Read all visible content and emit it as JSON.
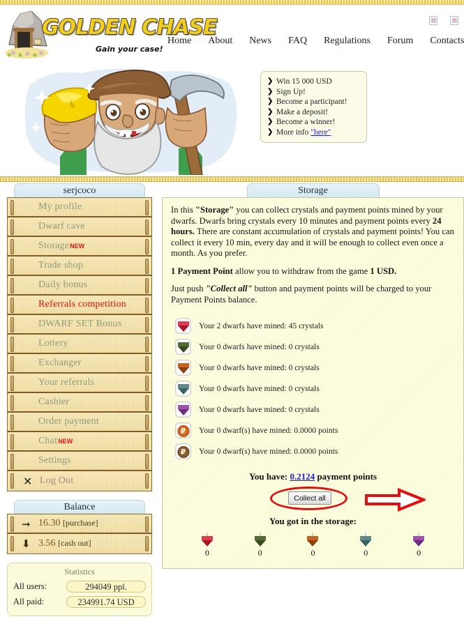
{
  "site": {
    "logo_text": "GOLDEN CHASE",
    "slogan": "Gain your case!"
  },
  "nav": {
    "items": [
      {
        "label": "Home"
      },
      {
        "label": "About"
      },
      {
        "label": "News"
      },
      {
        "label": "FAQ"
      },
      {
        "label": "Regulations"
      },
      {
        "label": "Forum"
      },
      {
        "label": "Contacts"
      }
    ]
  },
  "promo": {
    "items": [
      "Win 15 000 USD",
      "Sign Up!",
      "Become a participant!",
      "Make a deposit!",
      "Become a winner!"
    ],
    "more_info_prefix": "More info",
    "more_info_link": "\"here\""
  },
  "sidebar": {
    "user_tab": "serjcoco",
    "items": [
      {
        "label": "My profile",
        "state": "normal",
        "badge": ""
      },
      {
        "label": "Dwarf cave",
        "state": "normal",
        "badge": ""
      },
      {
        "label": "Storage",
        "state": "normal",
        "badge": "NEW"
      },
      {
        "label": "Trade shop",
        "state": "normal",
        "badge": ""
      },
      {
        "label": "Daily bonus",
        "state": "normal",
        "badge": ""
      },
      {
        "label": "Referrals competition",
        "state": "active",
        "badge": ""
      },
      {
        "label": "DWARF SET Bonus",
        "state": "normal",
        "badge": ""
      },
      {
        "label": "Lottery",
        "state": "normal",
        "badge": ""
      },
      {
        "label": "Exchanger",
        "state": "normal",
        "badge": ""
      },
      {
        "label": "Your referrals",
        "state": "normal",
        "badge": ""
      },
      {
        "label": "Cashier",
        "state": "normal",
        "badge": ""
      },
      {
        "label": "Order payment",
        "state": "normal",
        "badge": ""
      },
      {
        "label": "Chat",
        "state": "normal",
        "badge": "NEW"
      },
      {
        "label": "Settings",
        "state": "normal",
        "badge": ""
      },
      {
        "label": "Log Out",
        "state": "logout",
        "badge": ""
      }
    ],
    "balance": {
      "title": "Balance",
      "rows": [
        {
          "icon": "arrow-right-icon",
          "amount": "16.30",
          "tag": "[purchase]"
        },
        {
          "icon": "arrow-down-icon",
          "amount": "3.56",
          "tag": "[cash out]"
        }
      ]
    },
    "statistics": {
      "title": "Statistics",
      "rows": [
        {
          "label": "All users:",
          "value": "294049 ppl."
        },
        {
          "label": "All paid:",
          "value": "234991.74 USD"
        }
      ]
    }
  },
  "content": {
    "tab_title": "Storage",
    "paragraph1_a": "In this ",
    "paragraph1_b": "\"Storage\"",
    "paragraph1_c": " you can collect crystals and payment points mined by your dwarfs. Dwarfs bring crystals every 10 minutes and payment points every ",
    "paragraph1_d": "24 hours.",
    "paragraph1_e": " There are constant accumulation of crystals and payment points! You can collect it every 10 min, every day and it will be enough to collect even once a month. As you prefer.",
    "paragraph2_a": "1 Payment Point",
    "paragraph2_b": " allow you to withdraw from the game ",
    "paragraph2_c": "1 USD.",
    "paragraph3_a": "Just push ",
    "paragraph3_b": "\"Collect all\"",
    "paragraph3_c": " button and payment points will be charged to your Payment Points balance.",
    "mined_rows": [
      {
        "icon": "red-crystal-icon",
        "color": "#e23a4e",
        "dark": "#a5172a",
        "text": "Your 2 dwarfs have mined: 45 crystals"
      },
      {
        "icon": "green-crystal-icon",
        "color": "#556b33",
        "dark": "#394a1f",
        "text": "Your 0 dwarfs have mined: 0 crystals"
      },
      {
        "icon": "orange-crystal-icon",
        "color": "#c9641c",
        "dark": "#8c4210",
        "text": "Your 0 dwarfs have mined: 0 crystals"
      },
      {
        "icon": "teal-crystal-icon",
        "color": "#5e8a8a",
        "dark": "#3d6263",
        "text": "Your 0 dwarfs have mined: 0 crystals"
      },
      {
        "icon": "purple-crystal-icon",
        "color": "#a24fb0",
        "dark": "#6f2e7d",
        "text": "Your 0 dwarfs have mined: 0 crystals"
      },
      {
        "icon": "orange-coin-icon",
        "color": "#d2691e",
        "dark": "#a34a10",
        "text": "Your 0 dwarf(s) have mined: 0.0000 points",
        "glyph": "₽"
      },
      {
        "icon": "brown-coin-icon",
        "color": "#8a5a2b",
        "dark": "#5e3b17",
        "text": "Your 0 dwarf(s) have mined: 0.0000 points",
        "glyph": "₽"
      }
    ],
    "have_prefix": "You have: ",
    "have_value": "0.2124",
    "have_suffix": " payment points",
    "collect_button": "Collect all",
    "got_title": "You got in the storage:",
    "storage_cells": [
      {
        "icon": "red-crystal-icon",
        "color": "#e23a4e",
        "dark": "#a5172a",
        "count": "0"
      },
      {
        "icon": "green-crystal-icon",
        "color": "#556b33",
        "dark": "#394a1f",
        "count": "0"
      },
      {
        "icon": "orange-crystal-icon",
        "color": "#c9641c",
        "dark": "#8c4210",
        "count": "0"
      },
      {
        "icon": "teal-crystal-icon",
        "color": "#5e8a8a",
        "dark": "#3d6263",
        "count": "0"
      },
      {
        "icon": "purple-crystal-icon",
        "color": "#a24fb0",
        "dark": "#6f2e7d",
        "count": "0"
      }
    ]
  },
  "colors": {
    "accent_red": "#e01010",
    "panel_bg": "#fbfbd0",
    "plank_bg": "#f4e3ac",
    "tab_blue": "#d5e9f2"
  }
}
